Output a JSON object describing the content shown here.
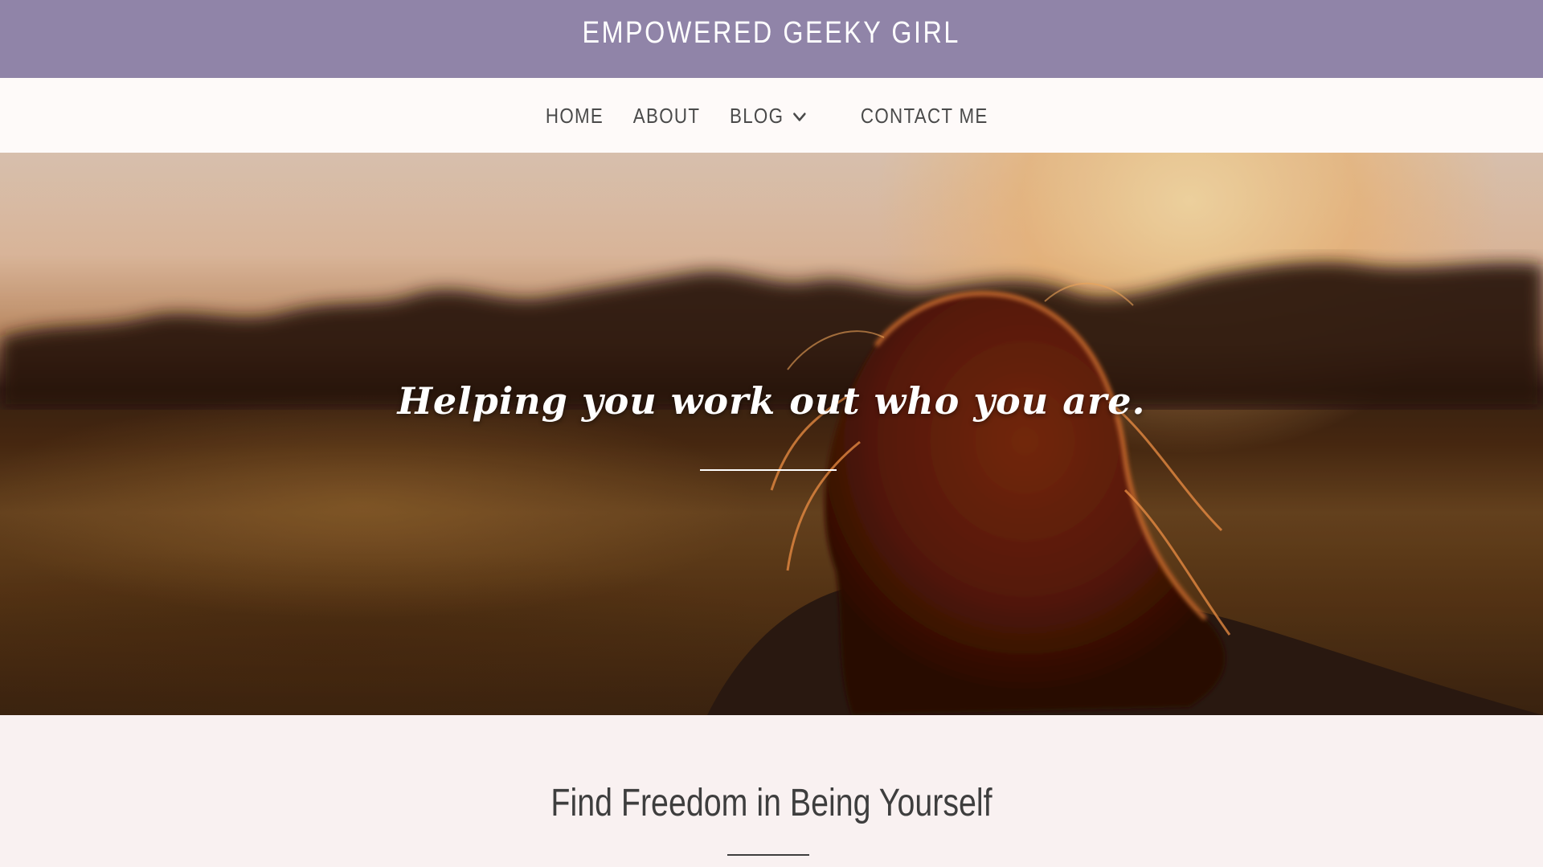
{
  "site": {
    "title": "EMPOWERED GEEKY GIRL"
  },
  "nav": {
    "items": [
      {
        "label": "HOME"
      },
      {
        "label": "ABOUT"
      },
      {
        "label": "BLOG",
        "has_dropdown": true,
        "icon": "chevron-down-icon"
      },
      {
        "label": "CONTACT ME"
      }
    ]
  },
  "hero": {
    "tagline": "Helping you work out who you are."
  },
  "section": {
    "title": "Find Freedom in Being Yourself"
  },
  "colors": {
    "brand_bar": "#9084a8",
    "nav_background": "#fefaf9",
    "page_background": "#f9f1f1",
    "nav_text": "#4a4a4a",
    "heading_text": "#3e3e3e"
  }
}
